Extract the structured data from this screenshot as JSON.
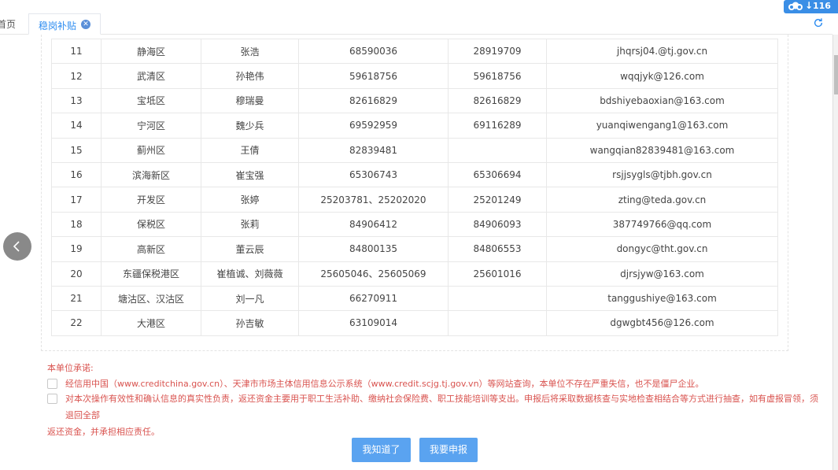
{
  "tabs": {
    "home_label": "首页",
    "active_label": "稳岗补贴"
  },
  "badge": {
    "count": "116"
  },
  "table": {
    "rows": [
      [
        "11",
        "静海区",
        "张浩",
        "68590036",
        "28919709",
        "jhqrsj04.@tj.gov.cn"
      ],
      [
        "12",
        "武清区",
        "孙艳伟",
        "59618756",
        "59618756",
        "wqqjyk@126.com"
      ],
      [
        "13",
        "宝坻区",
        "穆瑞曼",
        "82616829",
        "82616829",
        "bdshiyebaoxian@163.com"
      ],
      [
        "14",
        "宁河区",
        "魏少兵",
        "69592959",
        "69116289",
        "yuanqiwengang1@163.com"
      ],
      [
        "15",
        "蓟州区",
        "王倩",
        "82839481",
        "",
        "wangqian82839481@163.com"
      ],
      [
        "16",
        "滨海新区",
        "崔宝强",
        "65306743",
        "65306694",
        "rsjjsygls@tjbh.gov.cn"
      ],
      [
        "17",
        "开发区",
        "张婷",
        "25203781、25202020",
        "25201249",
        "zting@teda.gov.cn"
      ],
      [
        "18",
        "保税区",
        "张莉",
        "84906412",
        "84906093",
        "387749766@qq.com"
      ],
      [
        "19",
        "高新区",
        "董云辰",
        "84800135",
        "84806553",
        "dongyc@tht.gov.cn"
      ],
      [
        "20",
        "东疆保税港区",
        "崔植诚、刘薇薇",
        "25605046、25605069",
        "25601016",
        "djrsjyw@163.com"
      ],
      [
        "21",
        "塘沽区、汉沽区",
        "刘一凡",
        "66270911",
        "",
        "tanggushiye@163.com"
      ],
      [
        "22",
        "大港区",
        "孙吉敏",
        "63109014",
        "",
        "dgwgbt456@126.com"
      ]
    ]
  },
  "pledge": {
    "title": "本单位承诺:",
    "item1": "经信用中国（www.creditchina.gov.cn）、天津市市场主体信用信息公示系统（www.credit.scjg.tj.gov.vn）等网站查询，本单位不存在严重失信，也不是僵尸企业。",
    "item2_line1": "对本次操作有效性和确认信息的真实性负责，返还资金主要用于职工生活补助、缴纳社会保险费、职工技能培训等支出。申报后将采取数据核查与实地检查相结合等方式进行抽查，如有虚报冒领，须退回全部",
    "item2_line2": "返还资金，并承担相应责任。"
  },
  "buttons": {
    "know": "我知道了",
    "apply": "我要申报"
  },
  "colors": {
    "accent": "#2d8cf0",
    "button": "#5aa3f0",
    "warning_text": "#d9534f"
  },
  "icons": [
    "close-icon",
    "refresh-icon",
    "cloud-icon",
    "download-arrow-icon",
    "chevron-left-icon",
    "checkbox"
  ]
}
